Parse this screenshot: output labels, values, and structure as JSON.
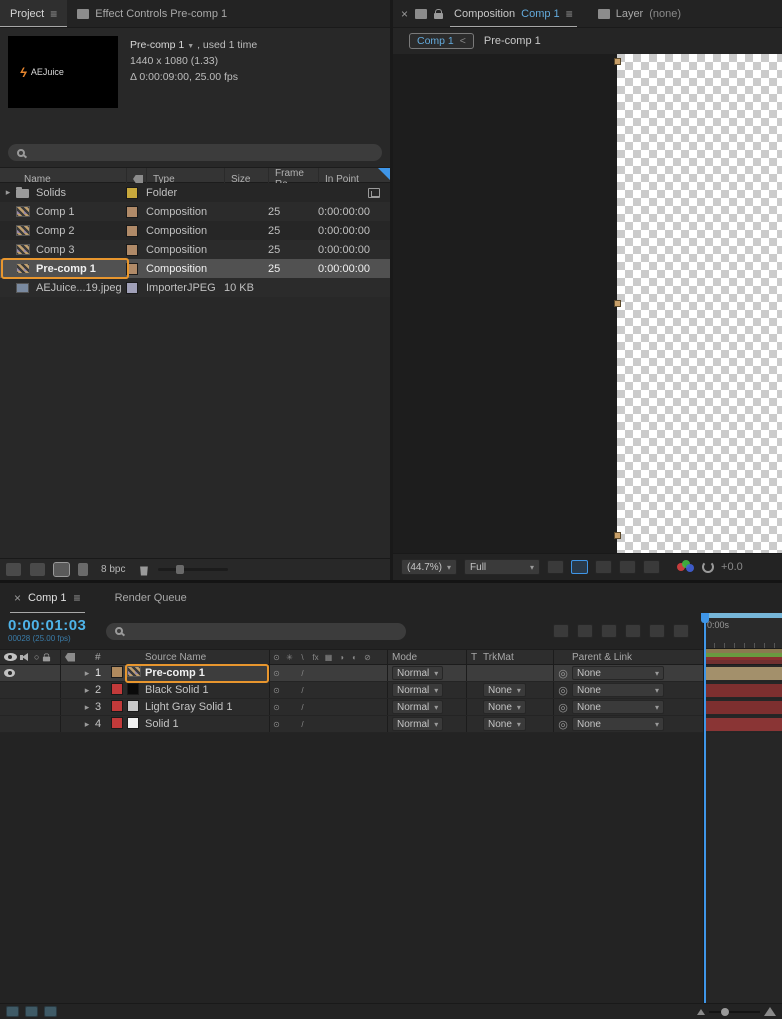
{
  "glyphs": {
    "menu": "≡",
    "close": "×",
    "caret": "▾",
    "chevron_right": "▸",
    "dropdown_open": "▼",
    "pickwhip": "◎",
    "solo": "○",
    "separator": "<",
    "quality": "/",
    "sw1": "⊙",
    "sw2": "✳",
    "sw3": "\\",
    "sw4": "fx",
    "sw5": "▦",
    "sw6": "◑",
    "sw7": "◐",
    "sw8": "⊘"
  },
  "colors": {
    "accent_blue": "#3f96e8",
    "timecode": "#4eb3e8",
    "annotation_orange": "#e8962e"
  },
  "project": {
    "tab": "Project",
    "effect_controls_tab": "Effect Controls Pre-comp 1",
    "preview": {
      "name": "Pre-comp 1",
      "usage": ", used 1 time",
      "dimensions": "1440 x 1080 (1.33)",
      "duration": "Δ 0:00:09:00, 25.00 fps",
      "thumbnail_text": "AEJuice"
    },
    "columns": {
      "name": "Name",
      "type": "Type",
      "size": "Size",
      "frame_rate": "Frame Ra..",
      "in_point": "In Point"
    },
    "rows": [
      {
        "name": "Solids",
        "type": "Folder",
        "size": "",
        "frame_rate": "",
        "in_point": "",
        "label_color": "#c8a83c"
      },
      {
        "name": "Comp 1",
        "type": "Composition",
        "size": "",
        "frame_rate": "25",
        "in_point": "0:00:00:00",
        "label_color": "#b08a68"
      },
      {
        "name": "Comp 2",
        "type": "Composition",
        "size": "",
        "frame_rate": "25",
        "in_point": "0:00:00:00",
        "label_color": "#b08a68"
      },
      {
        "name": "Comp 3",
        "type": "Composition",
        "size": "",
        "frame_rate": "25",
        "in_point": "0:00:00:00",
        "label_color": "#b08a68"
      },
      {
        "name": "Pre-comp 1",
        "type": "Composition",
        "size": "",
        "frame_rate": "25",
        "in_point": "0:00:00:00",
        "label_color": "#b08a68"
      },
      {
        "name": "AEJuice...19.jpeg",
        "type": "ImporterJPEG",
        "size": "10 KB",
        "frame_rate": "",
        "in_point": "",
        "label_color": "#a0a0b8"
      }
    ],
    "footer": {
      "bpc": "8 bpc"
    }
  },
  "composition": {
    "panel_label": "Composition",
    "comp_name": "Comp 1",
    "layer_panel_label": "Layer",
    "layer_panel_value": "(none)",
    "breadcrumb": {
      "parent": "Comp 1",
      "current": "Pre-comp 1"
    },
    "footer": {
      "zoom": "(44.7%)",
      "resolution": "Full",
      "exposure": "+0.0"
    }
  },
  "timeline": {
    "comp_tab": "Comp 1",
    "render_queue_tab": "Render Queue",
    "timecode": "0:00:01:03",
    "frame_info": "00028 (25.00 fps)",
    "ruler_start": "0:00s",
    "columns": {
      "number": "#",
      "source_name": "Source Name",
      "mode": "Mode",
      "t": "T",
      "trkmat": "TrkMat",
      "parent": "Parent & Link"
    },
    "layers": [
      {
        "number": "1",
        "name": "Pre-comp 1",
        "mode": "Normal",
        "parent": "None",
        "label_color": "#b08a5e",
        "bar_color": "#a3906b"
      },
      {
        "number": "2",
        "name": "Black Solid 1",
        "mode": "Normal",
        "trkmat": "None",
        "parent": "None",
        "label_color": "#c23a3a",
        "bar_color": "#7d2f2f",
        "icon_color": "#0a0a0a"
      },
      {
        "number": "3",
        "name": "Light Gray Solid 1",
        "mode": "Normal",
        "trkmat": "None",
        "parent": "None",
        "label_color": "#c23a3a",
        "bar_color": "#7d2f2f",
        "icon_color": "#c8c8c8"
      },
      {
        "number": "4",
        "name": "Solid 1",
        "mode": "Normal",
        "trkmat": "None",
        "parent": "None",
        "label_color": "#c23a3a",
        "bar_color": "#8a3535",
        "icon_color": "#f0f0f0"
      }
    ],
    "navigator_colors": [
      "#8a7a50",
      "#6a9a40",
      "#8a3030",
      "#703030"
    ]
  }
}
